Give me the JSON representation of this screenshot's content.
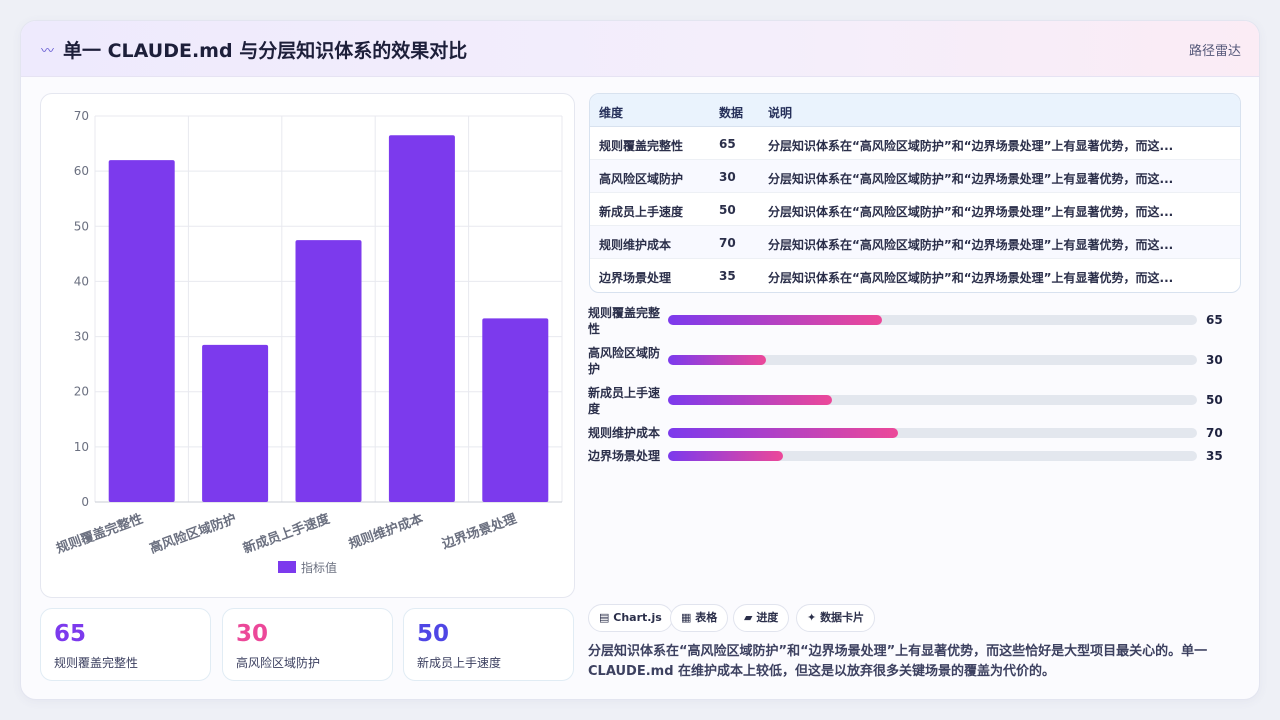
{
  "header": {
    "title_icon": "〰",
    "title": "单一 CLAUDE.md 与分层知识体系的效果对比",
    "right_label": "路径雷达"
  },
  "chart_data": {
    "type": "bar",
    "categories": [
      "规则覆盖完整性",
      "高风险区域防护",
      "新成员上手速度",
      "规则维护成本",
      "边界场景处理"
    ],
    "series": [
      {
        "name": "指标值",
        "values": [
          62,
          28.5,
          47.5,
          66.5,
          33.3
        ],
        "color": "#7c3aed"
      }
    ],
    "ylim": [
      0,
      70
    ],
    "yticks": [
      0,
      10,
      20,
      30,
      40,
      50,
      60,
      70
    ],
    "grid": true,
    "legend": "bottom"
  },
  "stats": [
    {
      "value": "65",
      "label": "规则覆盖完整性",
      "color": "#7c3aed"
    },
    {
      "value": "30",
      "label": "高风险区域防护",
      "color": "#ec4899"
    },
    {
      "value": "50",
      "label": "新成员上手速度",
      "color": "#4f46e5"
    }
  ],
  "table": {
    "headers": [
      "维度",
      "数据",
      "说明"
    ],
    "rows": [
      [
        "规则覆盖完整性",
        "65",
        "分层知识体系在“高风险区域防护”和“边界场景处理”上有显著优势，而这..."
      ],
      [
        "高风险区域防护",
        "30",
        "分层知识体系在“高风险区域防护”和“边界场景处理”上有显著优势，而这..."
      ],
      [
        "新成员上手速度",
        "50",
        "分层知识体系在“高风险区域防护”和“边界场景处理”上有显著优势，而这..."
      ],
      [
        "规则维护成本",
        "70",
        "分层知识体系在“高风险区域防护”和“边界场景处理”上有显著优势，而这..."
      ],
      [
        "边界场景处理",
        "35",
        "分层知识体系在“高风险区域防护”和“边界场景处理”上有显著优势，而这..."
      ]
    ]
  },
  "progress": [
    {
      "label": "规则覆盖完整性",
      "value": "65",
      "fraction": 0.405
    },
    {
      "label": "高风险区域防护",
      "value": "30",
      "fraction": 0.186
    },
    {
      "label": "新成员上手速度",
      "value": "50",
      "fraction": 0.31
    },
    {
      "label": "规则维护成本",
      "value": "70",
      "fraction": 0.435
    },
    {
      "label": "边界场景处理",
      "value": "35",
      "fraction": 0.217
    }
  ],
  "chips": [
    {
      "icon": "▤",
      "label": "Chart.js"
    },
    {
      "icon": "▦",
      "label": "表格"
    },
    {
      "icon": "▰",
      "label": "进度"
    },
    {
      "icon": "✦",
      "label": "数据卡片"
    }
  ],
  "summary": "分层知识体系在“高风险区域防护”和“边界场景处理”上有显著优势，而这些恰好是大型项目最关心的。单一 CLAUDE.md 在维护成本上较低，但这是以放弃很多关键场景的覆盖为代价的。"
}
